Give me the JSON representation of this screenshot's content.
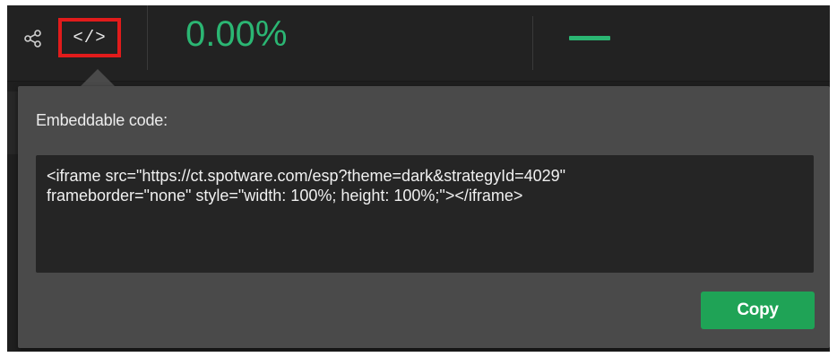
{
  "toolbar": {
    "share_icon": "share-icon",
    "embed_icon_glyph": "</>",
    "return_percent": "0.00%",
    "secondary_value": "—"
  },
  "embed_popup": {
    "title": "Embeddable code:",
    "code_line_1": "<iframe src=\"https://ct.spotware.com/esp?theme=dark&strategyId=4029\"",
    "code_line_2": "frameborder=\"none\" style=\"width: 100%; height: 100%;\"></iframe>",
    "copy_label": "Copy"
  },
  "colors": {
    "background": "#1f1f1f",
    "popup": "#4a4a4a",
    "code_box": "#252525",
    "accent_green": "#2bb673",
    "button_green": "#1fa356",
    "highlight_red": "#e11b1b"
  }
}
